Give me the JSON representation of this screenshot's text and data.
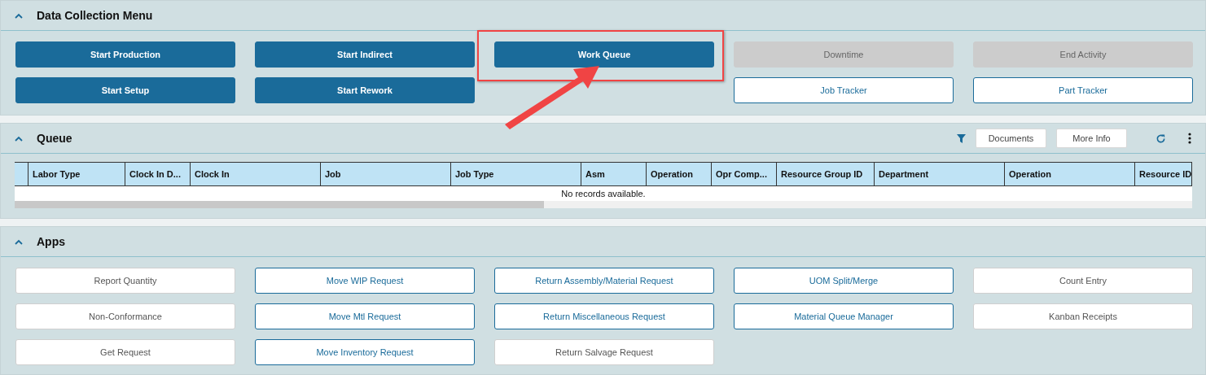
{
  "data_collection": {
    "title": "Data Collection Menu",
    "expanded": true,
    "columns": [
      [
        {
          "label": "Start Production",
          "kind": "primary",
          "highlighted": false
        },
        {
          "label": "Start Setup",
          "kind": "primary",
          "highlighted": false
        }
      ],
      [
        {
          "label": "Start Indirect",
          "kind": "primary",
          "highlighted": false
        },
        {
          "label": "Start Rework",
          "kind": "primary",
          "highlighted": false
        }
      ],
      [
        {
          "label": "Work Queue",
          "kind": "primary",
          "highlighted": true
        }
      ],
      [
        {
          "label": "Downtime",
          "kind": "disabled",
          "highlighted": false
        },
        {
          "label": "Job Tracker",
          "kind": "outline",
          "highlighted": false
        }
      ],
      [
        {
          "label": "End Activity",
          "kind": "disabled",
          "highlighted": false
        },
        {
          "label": "Part Tracker",
          "kind": "outline",
          "highlighted": false
        }
      ]
    ]
  },
  "queue": {
    "title": "Queue",
    "expanded": true,
    "toolbar_buttons": [
      "Documents",
      "More Info"
    ],
    "table": {
      "columns": [
        "Labor Type",
        "Clock In D...",
        "Clock In",
        "Job",
        "Job Type",
        "Asm",
        "Operation",
        "Opr Comp...",
        "Resource Group ID",
        "Department",
        "Operation",
        "Resource ID"
      ],
      "empty_message": "No records available."
    }
  },
  "apps": {
    "title": "Apps",
    "expanded": true,
    "columns": [
      [
        {
          "label": "Report Quantity",
          "kind": "plain"
        },
        {
          "label": "Non-Conformance",
          "kind": "plain"
        },
        {
          "label": "Get Request",
          "kind": "plain"
        }
      ],
      [
        {
          "label": "Move WIP Request",
          "kind": "outline"
        },
        {
          "label": "Move Mtl Request",
          "kind": "outline"
        },
        {
          "label": "Move Inventory Request",
          "kind": "outline"
        }
      ],
      [
        {
          "label": "Return Assembly/Material Request",
          "kind": "outline"
        },
        {
          "label": "Return Miscellaneous Request",
          "kind": "outline"
        },
        {
          "label": "Return Salvage Request",
          "kind": "plain"
        }
      ],
      [
        {
          "label": "UOM Split/Merge",
          "kind": "outline"
        },
        {
          "label": "Material Queue Manager",
          "kind": "outline"
        }
      ],
      [
        {
          "label": "Count Entry",
          "kind": "plain"
        },
        {
          "label": "Kanban Receipts",
          "kind": "plain"
        }
      ]
    ]
  }
}
